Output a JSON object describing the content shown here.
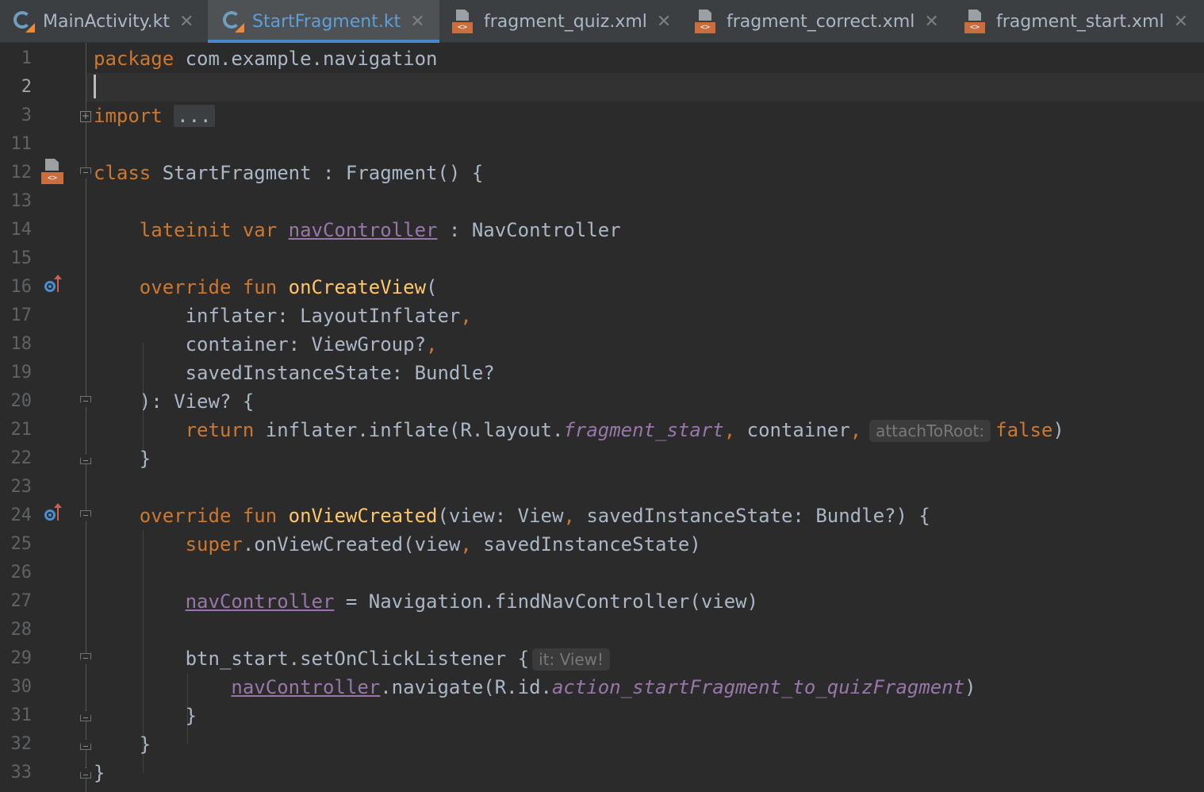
{
  "tabs": [
    {
      "label": "MainActivity.kt",
      "icon": "kotlin-file-icon",
      "active": false
    },
    {
      "label": "StartFragment.kt",
      "icon": "kotlin-file-icon",
      "active": true
    },
    {
      "label": "fragment_quiz.xml",
      "icon": "xml-layout-icon",
      "active": false
    },
    {
      "label": "fragment_correct.xml",
      "icon": "xml-layout-icon",
      "active": false
    },
    {
      "label": "fragment_start.xml",
      "icon": "xml-layout-icon",
      "active": false
    }
  ],
  "tab_close_glyph": "✕",
  "xml_glyph": "<>",
  "line_numbers": [
    "1",
    "2",
    "3",
    "11",
    "12",
    "13",
    "14",
    "15",
    "16",
    "17",
    "18",
    "19",
    "20",
    "21",
    "22",
    "23",
    "24",
    "25",
    "26",
    "27",
    "28",
    "29",
    "30",
    "31",
    "32",
    "33"
  ],
  "code": {
    "l1_kw": "package",
    "l1_rest": " com.example.navigation",
    "l3_kw": "import",
    "l3_fold": "...",
    "l12_kw": "class",
    "l12_rest": " StartFragment : Fragment() {",
    "l14_kw": "lateinit var",
    "l14_prop": "navController",
    "l14_rest": " : NavController",
    "l16_kw": "override fun",
    "l16_fn": "onCreateView",
    "l16_rest": "(",
    "l17_a": "inflater: LayoutInflater",
    "l17_comma": ",",
    "l18_a": "container: ViewGroup?",
    "l18_comma": ",",
    "l19_a": "savedInstanceState: Bundle?",
    "l20": "): View? {",
    "l21_kw": "return",
    "l21_a": " inflater.inflate(R.layout.",
    "l21_ital": "fragment_start",
    "l21_comma": ",",
    "l21_b": " container",
    "l21_comma2": ",",
    "l21_hint": "attachToRoot:",
    "l21_false": "false",
    "l21_end": ")",
    "l22": "}",
    "l24_kw": "override fun",
    "l24_fn": "onViewCreated",
    "l24_a": "(view: View",
    "l24_comma": ",",
    "l24_b": " savedInstanceState: Bundle?) {",
    "l25_kw": "super",
    "l25_a": ".onViewCreated(view",
    "l25_comma": ",",
    "l25_b": " savedInstanceState)",
    "l27_prop": "navController",
    "l27_rest": " = Navigation.findNavController(view)",
    "l29_a": "btn_start.setOnClickListener {",
    "l29_hint": "it: View!",
    "l30_prop": "navController",
    "l30_a": ".navigate(R.id.",
    "l30_ital": "action_startFragment_to_quizFragment",
    "l30_end": ")",
    "l31": "}",
    "l32": "}",
    "l33": "}"
  },
  "colors": {
    "background": "#2b2b2b",
    "keyword": "#cc7832",
    "function": "#ffc66d",
    "property": "#9876aa",
    "text": "#a9b7c6",
    "active_tab_accent": "#4a88c7"
  }
}
